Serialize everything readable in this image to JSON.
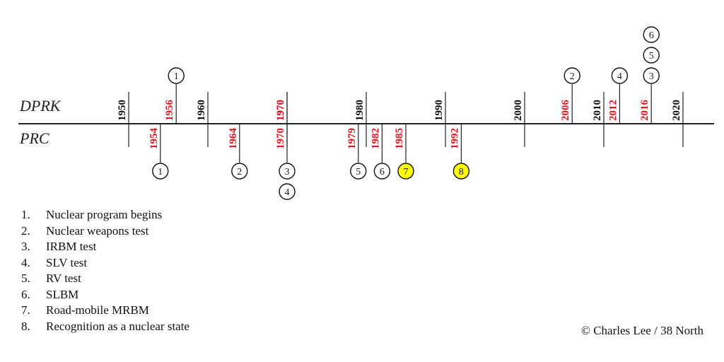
{
  "chart_data": {
    "type": "timeline",
    "title": "",
    "rows": [
      {
        "name": "DPRK",
        "side": "top"
      },
      {
        "name": "PRC",
        "side": "bottom"
      }
    ],
    "axis": {
      "xlim": [
        1937,
        2024
      ],
      "decade_ticks": [
        1950,
        1960,
        1970,
        1980,
        1990,
        2000,
        2010,
        2020
      ]
    },
    "events": [
      {
        "country": "DPRK",
        "year": 1956,
        "milestones": [
          1
        ]
      },
      {
        "country": "DPRK",
        "year": 1970,
        "milestones": []
      },
      {
        "country": "DPRK",
        "year": 2006,
        "milestones": [
          2
        ]
      },
      {
        "country": "DPRK",
        "year": 2012,
        "milestones": [
          4
        ]
      },
      {
        "country": "DPRK",
        "year": 2016,
        "milestones": [
          3,
          5,
          6
        ]
      },
      {
        "country": "PRC",
        "year": 1954,
        "milestones": [
          1
        ]
      },
      {
        "country": "PRC",
        "year": 1964,
        "milestones": [
          2
        ]
      },
      {
        "country": "PRC",
        "year": 1970,
        "milestones": [
          3,
          4
        ]
      },
      {
        "country": "PRC",
        "year": 1979,
        "milestones": [
          5
        ]
      },
      {
        "country": "PRC",
        "year": 1982,
        "milestones": [
          6
        ]
      },
      {
        "country": "PRC",
        "year": 1985,
        "milestones": [
          7
        ]
      },
      {
        "country": "PRC",
        "year": 1992,
        "milestones": [
          8
        ]
      }
    ],
    "highlighted_milestones": [
      7,
      8
    ],
    "colors": {
      "event_year": "#e8141c",
      "decade_year": "#111111",
      "highlight_fill": "#ffff00",
      "line": "#222222"
    }
  },
  "legend": [
    {
      "num": "1.",
      "label": "Nuclear program begins"
    },
    {
      "num": "2.",
      "label": "Nuclear weapons test"
    },
    {
      "num": "3.",
      "label": "IRBM test"
    },
    {
      "num": "4.",
      "label": "SLV test"
    },
    {
      "num": "5.",
      "label": "RV test"
    },
    {
      "num": "6.",
      "label": "SLBM"
    },
    {
      "num": "7.",
      "label": "Road-mobile MRBM"
    },
    {
      "num": "8.",
      "label": "Recognition as a nuclear state"
    }
  ],
  "credit": "© Charles Lee / 38 North"
}
